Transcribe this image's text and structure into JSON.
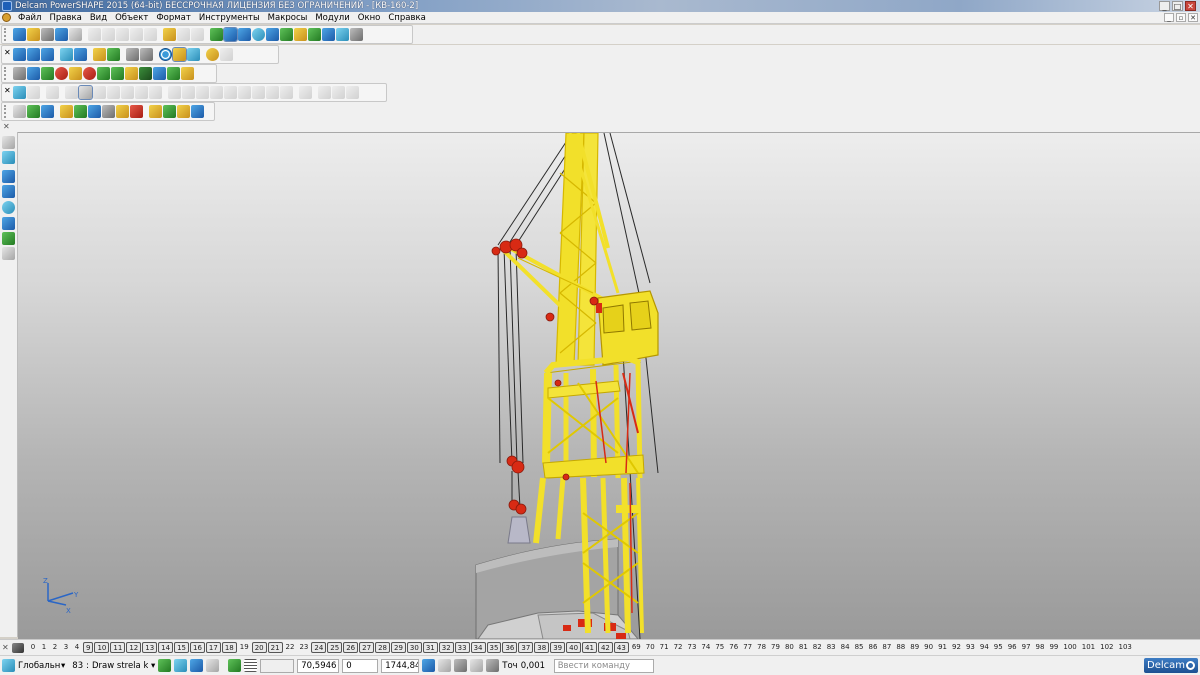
{
  "window": {
    "title": "Delcam PowerSHAPE 2015 (64-bit) БЕССРОЧНАЯ ЛИЦЕНЗИЯ БЕЗ ОГРАНИЧЕНИЙ - [КВ-160-2]",
    "controls": [
      "_",
      "□",
      "✕"
    ]
  },
  "menu": {
    "items": [
      "Файл",
      "Правка",
      "Вид",
      "Объект",
      "Формат",
      "Инструменты",
      "Макросы",
      "Модули",
      "Окно",
      "Справка"
    ],
    "mdi_controls": [
      "_",
      "▫",
      "✕"
    ]
  },
  "toolbars": {
    "row1": [
      "new-file-icon",
      "open-file-icon",
      "save-icon",
      "save-as-icon",
      "print-icon",
      "cut-icon",
      "copy-icon",
      "paste-icon",
      "draft-icon",
      "delete-icon",
      "undo-icon",
      "redo-icon",
      "edit-icon",
      "select-icon",
      "wireframe-icon",
      "cursor-icon",
      "circle-icon",
      "curve-icon",
      "text-icon",
      "dimension-icon",
      "solid-icon",
      "surface-icon",
      "mesh-icon",
      "tools-icon"
    ],
    "row2": [
      "view-top-icon",
      "view-front-icon",
      "view-side-icon",
      "iso-view-icon",
      "rotate-icon",
      "pan-icon",
      "zoom-in-icon",
      "zoom-out-icon",
      "zoom-fit-icon",
      "globe-icon",
      "shaded-icon",
      "wire-shade-icon",
      "light-icon",
      "hand-icon"
    ],
    "row3": [
      "layer-icon",
      "document-icon",
      "solid-box-icon",
      "sphere-icon",
      "cylinder-icon",
      "play-icon",
      "arrow-icon",
      "cube-icon",
      "frame-icon",
      "info-icon",
      "expand-icon"
    ],
    "row4": [
      "feature-icon",
      "tree-icon",
      "extrude-icon",
      "revolve-icon",
      "sweep-icon",
      "fillet-icon",
      "chamfer-icon",
      "shell-icon",
      "boolean-icon",
      "cut-solid-icon",
      "split-icon",
      "mirror-icon",
      "pattern-icon",
      "blend-icon",
      "offset-icon",
      "trim-icon"
    ],
    "row5": [
      "grid-icon",
      "axes-icon",
      "point-icon",
      "mesh-solid-icon",
      "paint-icon",
      "lock-icon",
      "cube-multi-icon",
      "camera-icon",
      "link-icon",
      "tag-icon",
      "grid-small-icon",
      "paint-bucket-icon",
      "measure-icon"
    ]
  },
  "left_toolbar": [
    "select-arrow-icon",
    "select-box-icon",
    "workplane-icon",
    "workplane-edit-icon",
    "sphere-pick-icon",
    "shade-icon",
    "axis-icon",
    "mesh-point-icon"
  ],
  "levels": {
    "items": [
      "0",
      "1",
      "2",
      "3",
      "4",
      "(9)",
      "(10)",
      "(11)",
      "(12)",
      "(13)",
      "(14)",
      "(15)",
      "(16)",
      "(17)",
      "(18)",
      "19",
      "(20)",
      "(21)",
      "22",
      "23",
      "(24)",
      "(25)",
      "(26)",
      "(27)",
      "(28)",
      "(29)",
      "(30)",
      "(31)",
      "(32)",
      "(33)",
      "(34)",
      "(35)",
      "(36)",
      "(37)",
      "(38)",
      "(39)",
      "(40)",
      "(41)",
      "(42)",
      "(43)",
      "69",
      "70",
      "71",
      "72",
      "73",
      "74",
      "75",
      "76",
      "77",
      "78",
      "79",
      "80",
      "81",
      "82",
      "83",
      "84",
      "85",
      "86",
      "87",
      "88",
      "89",
      "90",
      "91",
      "92",
      "93",
      "94",
      "95",
      "96",
      "97",
      "98",
      "99",
      "100",
      "101",
      "102",
      "103"
    ]
  },
  "status": {
    "workplane": "Глобальн",
    "level_num": "83",
    "level_name": "Draw strela k",
    "x_value": "70,5946",
    "y_value": "0",
    "z_value": "1744,84",
    "tol_label": "Точ",
    "tol_value": "0,001",
    "command_placeholder": "Ввести команду",
    "brand": "Delcam"
  },
  "colors": {
    "crane": "#f2e02a",
    "pulley": "#d82a14",
    "cable": "#2a2a2a",
    "base": "#9f9f9f"
  }
}
